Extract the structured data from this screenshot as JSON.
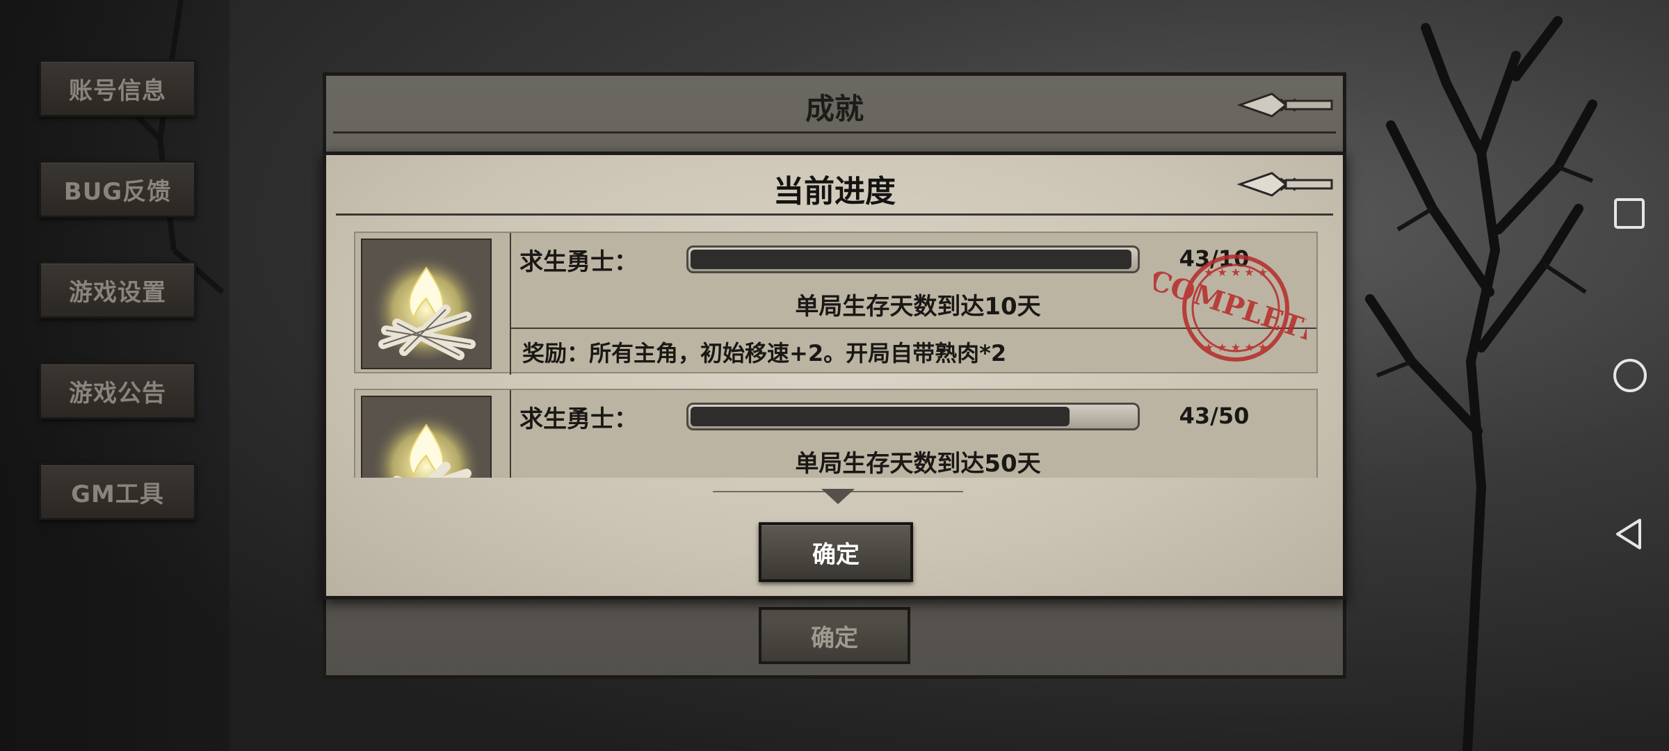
{
  "sidebar": {
    "items": [
      {
        "label": "账号信息"
      },
      {
        "label": "BUG反馈"
      },
      {
        "label": "游戏设置"
      },
      {
        "label": "游戏公告"
      },
      {
        "label": "GM工具"
      }
    ]
  },
  "background_panel": {
    "title": "成就",
    "confirm_label": "确定"
  },
  "dialog": {
    "title": "当前进度",
    "confirm_label": "确定",
    "achievements": [
      {
        "name": "求生勇士：",
        "progress_text": "43/10",
        "progress_fraction": 1.0,
        "description": "单局生存天数到达10天",
        "reward": "奖励：所有主角，初始移速+2。开局自带熟肉*2",
        "icon": "campfire-icon",
        "stamp": "COMPLETE"
      },
      {
        "name": "求生勇士：",
        "progress_text": "43/50",
        "progress_fraction": 0.86,
        "description": "单局生存天数到达50天",
        "icon": "campfire-icon"
      }
    ]
  },
  "system_nav": {
    "icons": [
      "recent-apps-icon",
      "home-icon",
      "back-icon"
    ]
  },
  "colors": {
    "stamp_red": "#b52a2a",
    "parchment": "#d3ccbd",
    "progress_fill": "#2e2d2b"
  }
}
